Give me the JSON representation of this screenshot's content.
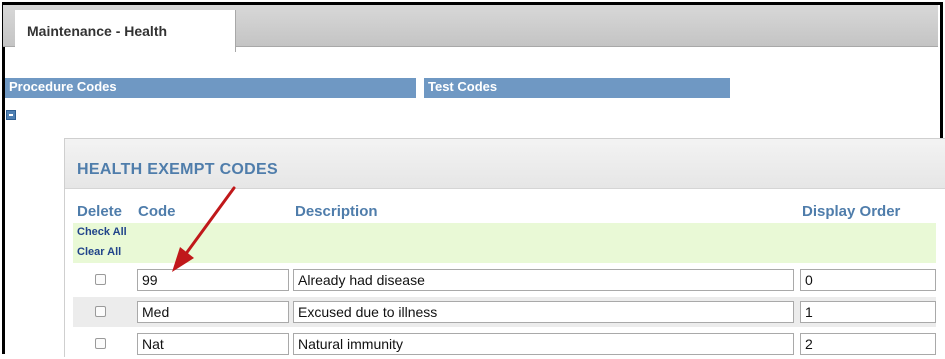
{
  "tab": {
    "label": "Maintenance - Health"
  },
  "sections": [
    {
      "label": "Procedure Codes"
    },
    {
      "label": "Test Codes"
    }
  ],
  "panel": {
    "title": "HEALTH EXEMPT CODES",
    "columns": {
      "delete": "Delete",
      "code": "Code",
      "description": "Description",
      "order": "Display Order"
    },
    "check_all": "Check All",
    "clear_all": "Clear All",
    "rows": [
      {
        "code": "99",
        "description": "Already had disease",
        "order": "0"
      },
      {
        "code": "Med",
        "description": "Excused due to illness",
        "order": "1"
      },
      {
        "code": "Nat",
        "description": "Natural immunity",
        "order": "2"
      }
    ]
  },
  "colors": {
    "section_bar": "#6f98c3",
    "panel_title": "#4f7dab",
    "check_band": "#e9f9d6",
    "arrow": "#c0181a"
  },
  "icons": {
    "collapse": "minus-icon",
    "annotation": "arrow-icon"
  }
}
